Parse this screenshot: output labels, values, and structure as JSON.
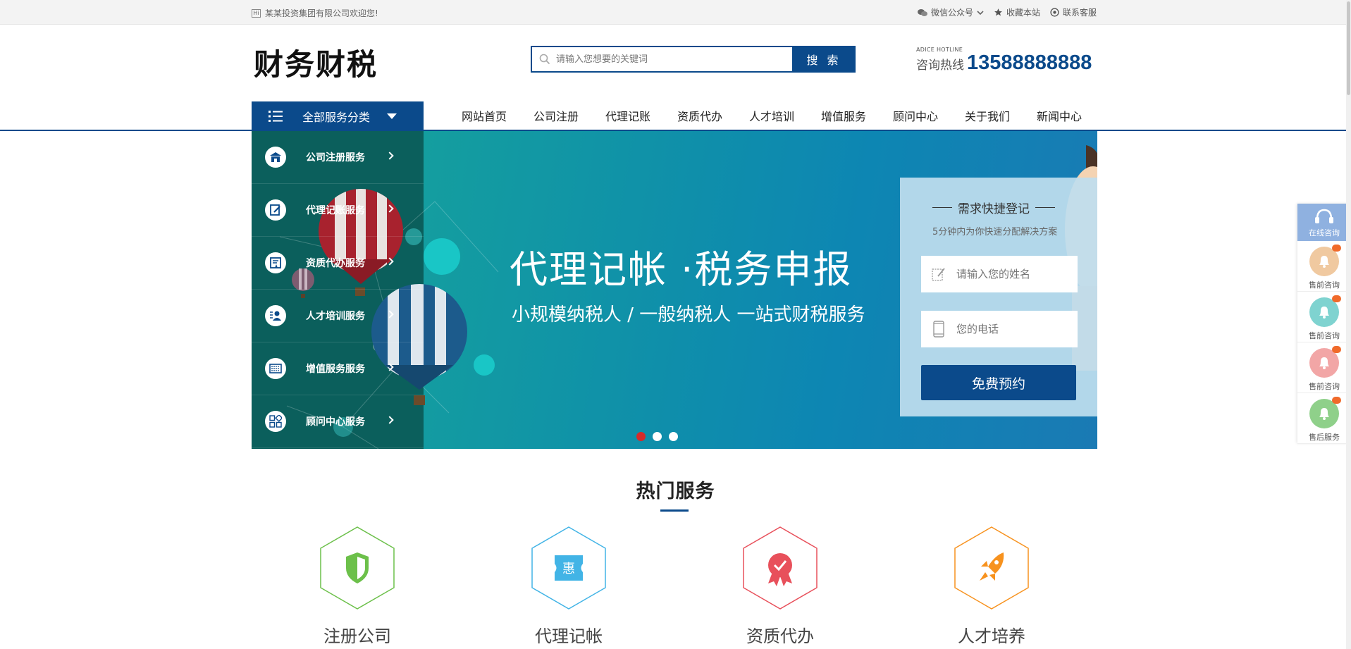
{
  "topbar": {
    "welcome": "某某投资集团有限公司欢迎您!",
    "wechat": "微信公众号",
    "favorite": "收藏本站",
    "contact": "联系客服"
  },
  "header": {
    "logo": "财务财税",
    "search_placeholder": "请输入您想要的关键词",
    "search_button": "搜 索",
    "hotline_en": "ADICE HOTLINE",
    "hotline_label": "咨询热线",
    "hotline_number": "13588888888"
  },
  "nav": {
    "all_categories": "全部服务分类",
    "items": [
      "网站首页",
      "公司注册",
      "代理记账",
      "资质代办",
      "人才培训",
      "增值服务",
      "顾问中心",
      "关于我们",
      "新闻中心"
    ]
  },
  "categories": [
    {
      "label": "公司注册服务",
      "icon": "building-icon"
    },
    {
      "label": "代理记账服务",
      "icon": "pen-icon"
    },
    {
      "label": "资质代办服务",
      "icon": "certificate-icon"
    },
    {
      "label": "人才培训服务",
      "icon": "person-icon"
    },
    {
      "label": "增值服务服务",
      "icon": "keyboard-icon"
    },
    {
      "label": "顾问中心服务",
      "icon": "grid-icon"
    }
  ],
  "banner": {
    "headline": "代理记帐 ·税务申报",
    "subline": "小规模纳税人 / 一般纳税人  一站式财税服务",
    "slides": 3,
    "active_slide": 1
  },
  "form": {
    "title": "需求快捷登记",
    "desc": "5分钟内为你快速分配解决方案",
    "name_placeholder": "请输入您的姓名",
    "phone_placeholder": "您的电话",
    "submit": "免费预约"
  },
  "hot": {
    "title": "热门服务",
    "services": [
      {
        "name": "注册公司",
        "color": "#6cc04a",
        "icon": "shield-icon"
      },
      {
        "name": "代理记帐",
        "color": "#42b4e6",
        "icon": "coupon-icon"
      },
      {
        "name": "资质代办",
        "color": "#e8505b",
        "icon": "badge-icon"
      },
      {
        "name": "人才培养",
        "color": "#f7921e",
        "icon": "rocket-icon"
      }
    ]
  },
  "float": {
    "online": "在线咨询",
    "items": [
      {
        "label": "售前咨询",
        "color": "#f0c9a0"
      },
      {
        "label": "售前咨询",
        "color": "#7fd3d0"
      },
      {
        "label": "售前咨询",
        "color": "#f2a6a6"
      },
      {
        "label": "售后服务",
        "color": "#8fd08a"
      }
    ]
  },
  "colors": {
    "brand": "#0b4a8b",
    "banner_teal": "#149e9f",
    "dot_active": "#d52b2b"
  }
}
